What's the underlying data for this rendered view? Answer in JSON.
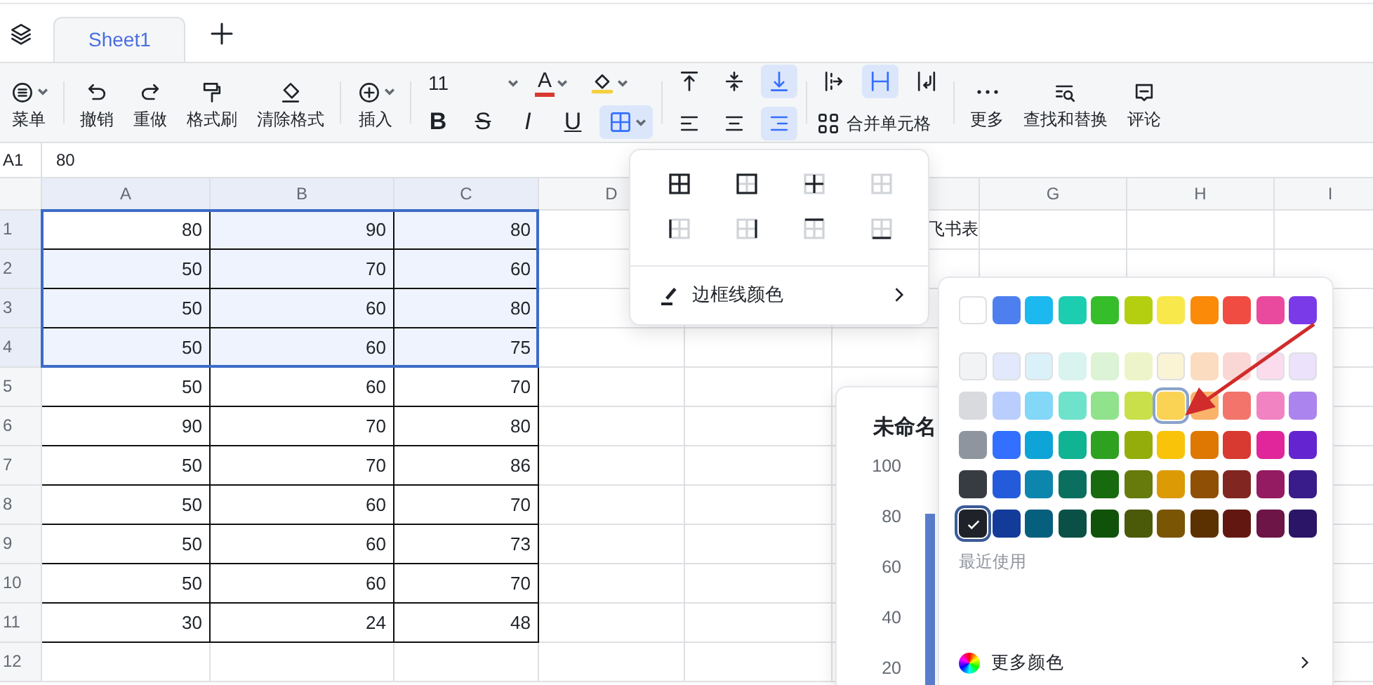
{
  "tabs": [
    {
      "label": "Sheet1",
      "selected": true
    }
  ],
  "toolbar": {
    "groups": [
      {
        "kind": "buttons",
        "items": [
          {
            "kind": "menu",
            "label": "菜单",
            "caret": true
          }
        ]
      },
      {
        "kind": "buttons",
        "items": [
          {
            "kind": "undo",
            "label": "撤销",
            "caret": false
          },
          {
            "kind": "redo",
            "label": "重做",
            "caret": false
          },
          {
            "kind": "brush",
            "label": "格式刷",
            "caret": false
          },
          {
            "kind": "eraser",
            "label": "清除格式",
            "caret": false
          }
        ]
      },
      {
        "kind": "buttons",
        "items": [
          {
            "kind": "insert",
            "label": "插入",
            "caret": true
          }
        ]
      },
      {
        "kind": "font",
        "font_size": "11",
        "color_glyph": "A",
        "styles": [
          {
            "kind": "bold",
            "glyph": "B"
          },
          {
            "kind": "strike",
            "glyph": "S"
          },
          {
            "kind": "italic",
            "glyph": "I"
          },
          {
            "kind": "underline",
            "glyph": "U"
          }
        ],
        "border_active": true
      },
      {
        "kind": "align",
        "vertical": [
          {
            "kind": "top",
            "selected": false
          },
          {
            "kind": "middle",
            "selected": false
          },
          {
            "kind": "bottom",
            "selected": true
          }
        ],
        "horizontal": [
          {
            "kind": "left",
            "selected": false
          },
          {
            "kind": "center",
            "selected": false
          },
          {
            "kind": "right",
            "selected": true
          }
        ]
      },
      {
        "kind": "merge",
        "wrap": [
          {
            "kind": "overflow",
            "selected": false
          },
          {
            "kind": "clip",
            "selected": true
          },
          {
            "kind": "wrap",
            "selected": false
          }
        ],
        "label": "合并单元格"
      },
      {
        "kind": "buttons",
        "items": [
          {
            "kind": "more",
            "label": "更多",
            "caret": false
          },
          {
            "kind": "find",
            "label": "查找和替换",
            "caret": false
          },
          {
            "kind": "comment",
            "label": "评论",
            "caret": false
          }
        ]
      }
    ]
  },
  "formula_bar": {
    "cell": "A1",
    "value": "80"
  },
  "columns": [
    {
      "label": "A",
      "selected": true
    },
    {
      "label": "B",
      "selected": true
    },
    {
      "label": "C",
      "selected": true
    },
    {
      "label": "D",
      "selected": false
    },
    {},
    {},
    {
      "label": "G",
      "selected": false
    },
    {
      "label": "H",
      "selected": false
    },
    {
      "label": "I",
      "selected": false
    }
  ],
  "rows": [
    {
      "label": "1",
      "selected": true,
      "cells": [
        "80",
        "90",
        "80"
      ],
      "column_f": "飞书表"
    },
    {
      "label": "2",
      "selected": true,
      "cells": [
        "50",
        "70",
        "60"
      ]
    },
    {
      "label": "3",
      "selected": true,
      "cells": [
        "50",
        "60",
        "80"
      ]
    },
    {
      "label": "4",
      "selected": true,
      "cells": [
        "50",
        "60",
        "75"
      ]
    },
    {
      "label": "5",
      "selected": false,
      "cells": [
        "50",
        "60",
        "70"
      ]
    },
    {
      "label": "6",
      "selected": false,
      "cells": [
        "90",
        "70",
        "80"
      ]
    },
    {
      "label": "7",
      "selected": false,
      "cells": [
        "50",
        "70",
        "86"
      ]
    },
    {
      "label": "8",
      "selected": false,
      "cells": [
        "50",
        "60",
        "70"
      ]
    },
    {
      "label": "9",
      "selected": false,
      "cells": [
        "50",
        "60",
        "73"
      ]
    },
    {
      "label": "10",
      "selected": false,
      "cells": [
        "50",
        "60",
        "70"
      ]
    },
    {
      "label": "11",
      "selected": false,
      "cells": [
        "30",
        "24",
        "48"
      ]
    },
    {
      "label": "12",
      "selected": false
    }
  ],
  "border_menu": {
    "options": [
      {
        "kind": "all"
      },
      {
        "kind": "outer"
      },
      {
        "kind": "inner"
      },
      {
        "kind": "none"
      },
      {
        "kind": "left"
      },
      {
        "kind": "right"
      },
      {
        "kind": "top"
      },
      {
        "kind": "bottom"
      }
    ],
    "color_label": "边框线颜色"
  },
  "chart": {
    "title": "未命名",
    "y_labels": [
      "100",
      "80",
      "60",
      "40",
      "20"
    ]
  },
  "palette": {
    "rows": [
      {
        "swatches": [
          {
            "color": "#ffffff",
            "selected": false,
            "highlighted": false
          },
          {
            "color": "#4e7fef",
            "selected": false,
            "highlighted": false
          },
          {
            "color": "#1cb8f0",
            "selected": false,
            "highlighted": false
          },
          {
            "color": "#1ccdb0",
            "selected": false,
            "highlighted": false
          },
          {
            "color": "#35bd2a",
            "selected": false,
            "highlighted": false
          },
          {
            "color": "#b3cf0f",
            "selected": false,
            "highlighted": false
          },
          {
            "color": "#f8e84c",
            "selected": false,
            "highlighted": false
          },
          {
            "color": "#fa8a08",
            "selected": false,
            "highlighted": false
          },
          {
            "color": "#f04c42",
            "selected": false,
            "highlighted": false
          },
          {
            "color": "#ea4a9d",
            "selected": false,
            "highlighted": false
          },
          {
            "color": "#7b3ae8",
            "selected": false,
            "highlighted": false
          }
        ]
      },
      {
        "swatches": [
          {
            "color": "#f2f3f5",
            "selected": false,
            "highlighted": false
          },
          {
            "color": "#e2e9fc",
            "selected": false,
            "highlighted": false
          },
          {
            "color": "#dbf1fa",
            "selected": false,
            "highlighted": false
          },
          {
            "color": "#d9f3ef",
            "selected": false,
            "highlighted": false
          },
          {
            "color": "#dcf3d6",
            "selected": false,
            "highlighted": false
          },
          {
            "color": "#eef4c9",
            "selected": false,
            "highlighted": false
          },
          {
            "color": "#fbf3d5",
            "selected": false,
            "highlighted": false
          },
          {
            "color": "#fbdcc0",
            "selected": false,
            "highlighted": false
          },
          {
            "color": "#fad7d5",
            "selected": false,
            "highlighted": false
          },
          {
            "color": "#fadcec",
            "selected": false,
            "highlighted": false
          },
          {
            "color": "#ece2fb",
            "selected": false,
            "highlighted": false
          }
        ]
      },
      {
        "swatches": [
          {
            "color": "#d9dadd",
            "selected": false,
            "highlighted": false
          },
          {
            "color": "#bacefd",
            "selected": false,
            "highlighted": false
          },
          {
            "color": "#82d8f6",
            "selected": false,
            "highlighted": false
          },
          {
            "color": "#6fe2cc",
            "selected": false,
            "highlighted": false
          },
          {
            "color": "#91e28c",
            "selected": false,
            "highlighted": false
          },
          {
            "color": "#c9e04a",
            "selected": false,
            "highlighted": false
          },
          {
            "color": "#fad355",
            "selected": false,
            "highlighted": true
          },
          {
            "color": "#fbb26a",
            "selected": false,
            "highlighted": false
          },
          {
            "color": "#f2746b",
            "selected": false,
            "highlighted": false
          },
          {
            "color": "#f283c2",
            "selected": false,
            "highlighted": false
          },
          {
            "color": "#ac84ee",
            "selected": false,
            "highlighted": false
          }
        ]
      },
      {
        "swatches": [
          {
            "color": "#8f959e",
            "selected": false,
            "highlighted": false
          },
          {
            "color": "#3370ff",
            "selected": false,
            "highlighted": false
          },
          {
            "color": "#0ea4d8",
            "selected": false,
            "highlighted": false
          },
          {
            "color": "#10b392",
            "selected": false,
            "highlighted": false
          },
          {
            "color": "#2ea121",
            "selected": false,
            "highlighted": false
          },
          {
            "color": "#95ad0a",
            "selected": false,
            "highlighted": false
          },
          {
            "color": "#f9c30a",
            "selected": false,
            "highlighted": false
          },
          {
            "color": "#de7802",
            "selected": false,
            "highlighted": false
          },
          {
            "color": "#d83931",
            "selected": false,
            "highlighted": false
          },
          {
            "color": "#e0269a",
            "selected": false,
            "highlighted": false
          },
          {
            "color": "#6425d0",
            "selected": false,
            "highlighted": false
          }
        ]
      },
      {
        "swatches": [
          {
            "color": "#373c43",
            "selected": false,
            "highlighted": false
          },
          {
            "color": "#245bdb",
            "selected": false,
            "highlighted": false
          },
          {
            "color": "#0d86ad",
            "selected": false,
            "highlighted": false
          },
          {
            "color": "#0b6f5f",
            "selected": false,
            "highlighted": false
          },
          {
            "color": "#186a0f",
            "selected": false,
            "highlighted": false
          },
          {
            "color": "#667b0c",
            "selected": false,
            "highlighted": false
          },
          {
            "color": "#dc9b04",
            "selected": false,
            "highlighted": false
          },
          {
            "color": "#8f4f04",
            "selected": false,
            "highlighted": false
          },
          {
            "color": "#812620",
            "selected": false,
            "highlighted": false
          },
          {
            "color": "#941a62",
            "selected": false,
            "highlighted": false
          },
          {
            "color": "#3a1b8a",
            "selected": false,
            "highlighted": false
          }
        ]
      },
      {
        "swatches": [
          {
            "color": "#1f2329",
            "selected": true,
            "highlighted": false
          },
          {
            "color": "#133c9a",
            "selected": false,
            "highlighted": false
          },
          {
            "color": "#075f7e",
            "selected": false,
            "highlighted": false
          },
          {
            "color": "#0a5046",
            "selected": false,
            "highlighted": false
          },
          {
            "color": "#10520a",
            "selected": false,
            "highlighted": false
          },
          {
            "color": "#4a5a08",
            "selected": false,
            "highlighted": false
          },
          {
            "color": "#7a5503",
            "selected": false,
            "highlighted": false
          },
          {
            "color": "#5c3102",
            "selected": false,
            "highlighted": false
          },
          {
            "color": "#621811",
            "selected": false,
            "highlighted": false
          },
          {
            "color": "#6c1546",
            "selected": false,
            "highlighted": false
          },
          {
            "color": "#2a1567",
            "selected": false,
            "highlighted": false
          }
        ]
      }
    ],
    "recent_label": "最近使用",
    "more_label": "更多颜色"
  }
}
